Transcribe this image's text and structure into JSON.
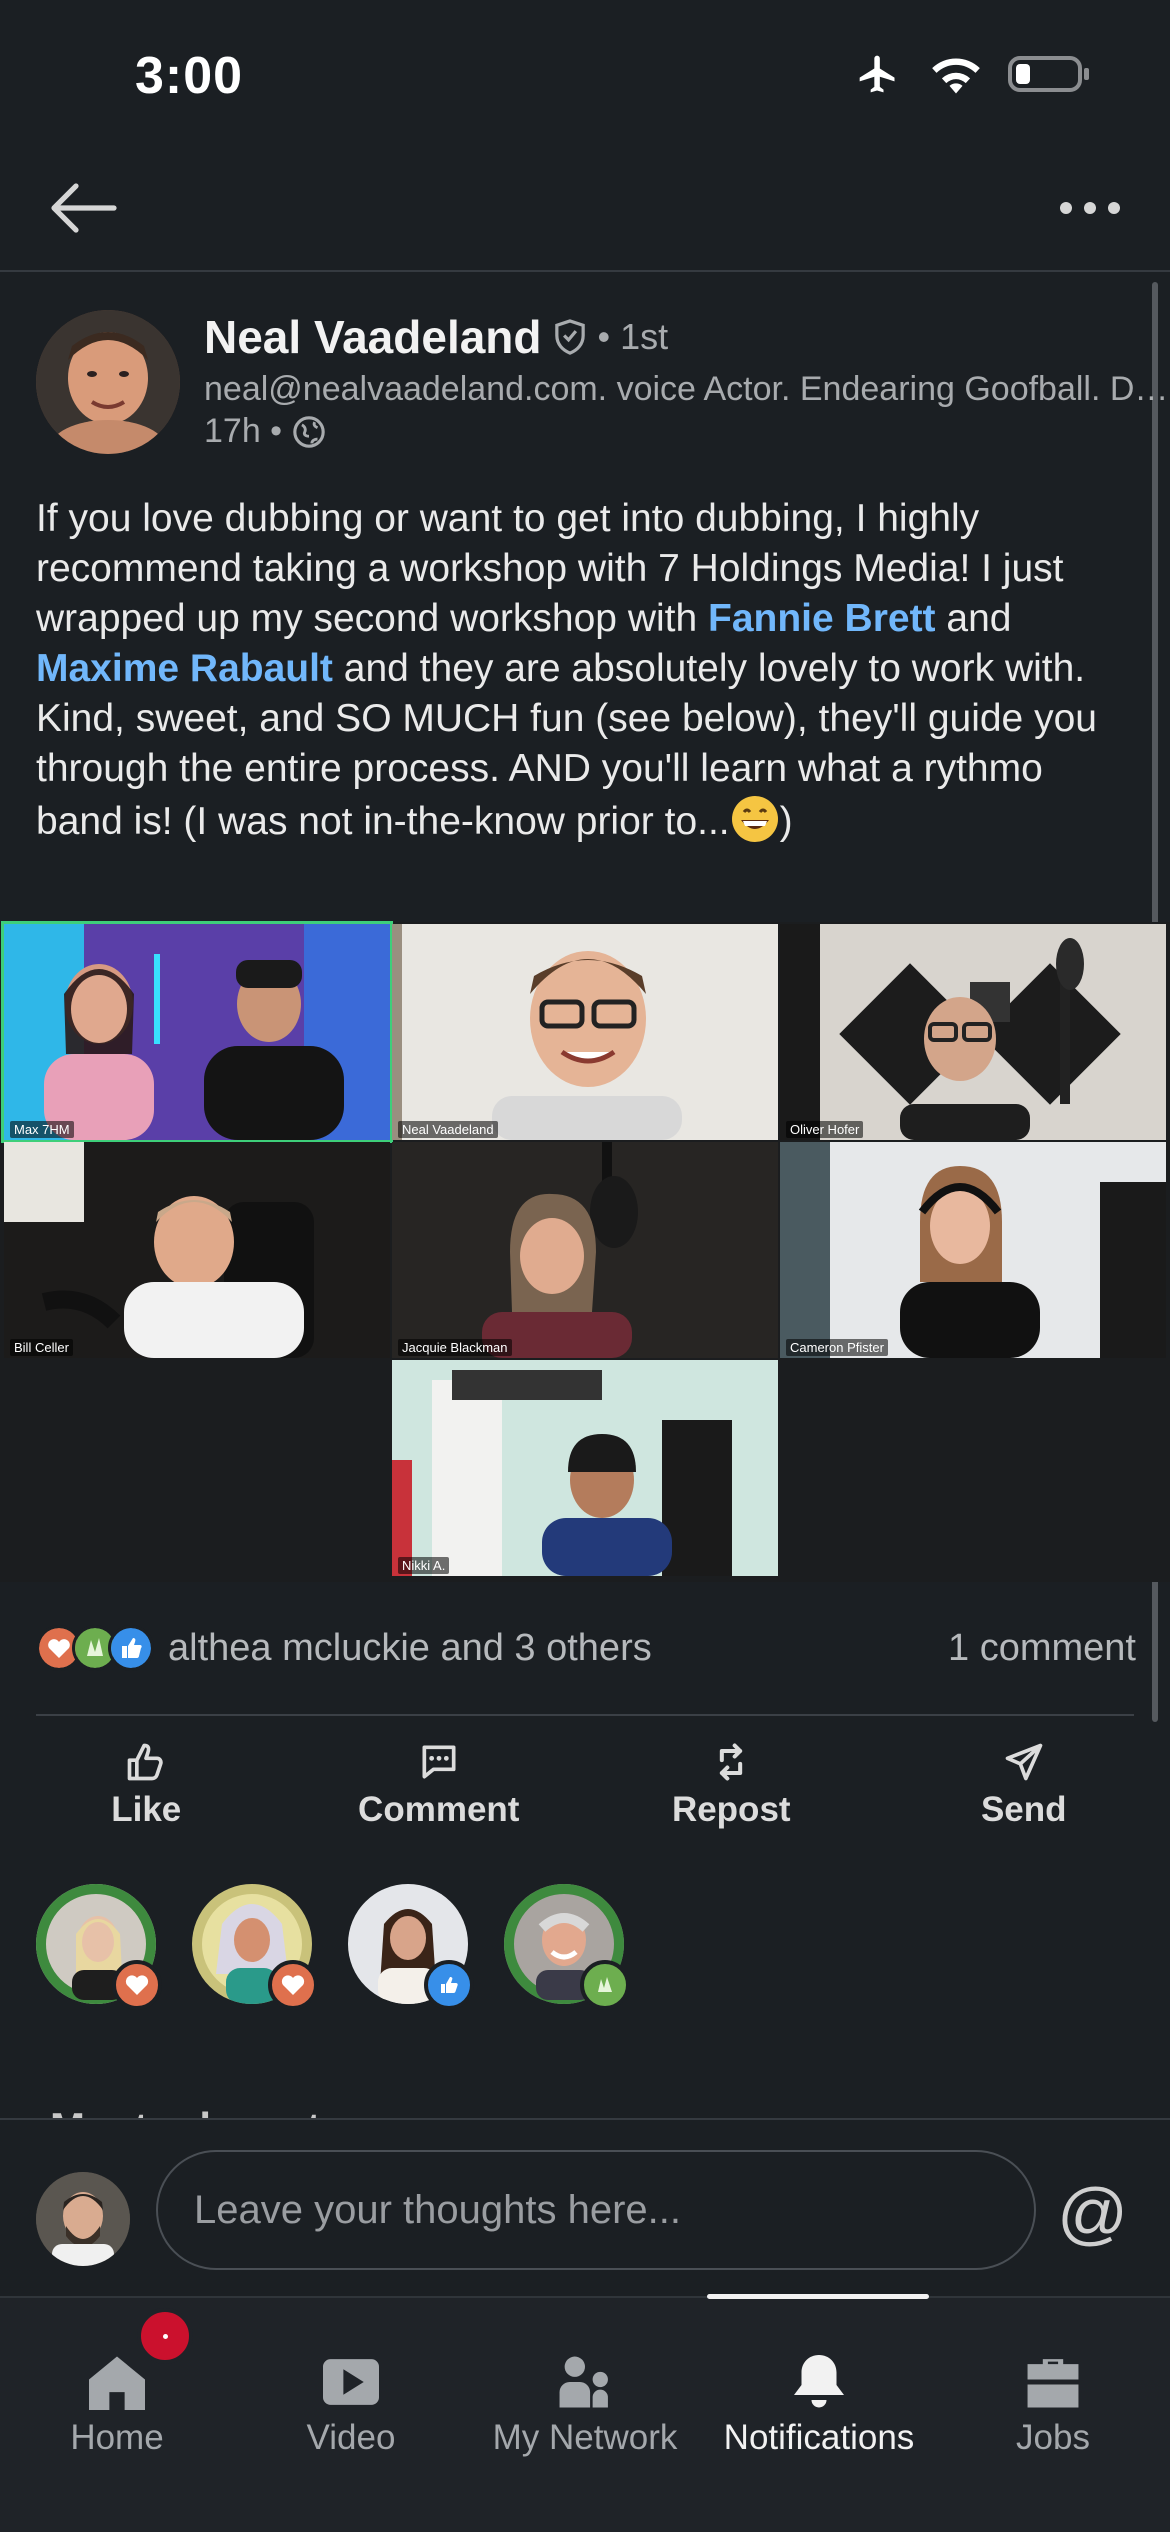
{
  "status_bar": {
    "time": "3:00"
  },
  "post": {
    "author": {
      "name": "Neal Vaadeland",
      "degree": "• 1st",
      "headline": "neal@nealvaadeland.com. voice Actor. Endearing Goofball. Dubbing.",
      "time": "17h •"
    },
    "body": {
      "part1": "If you love dubbing or want to get into dubbing, I highly recommend taking a workshop with 7 Holdings Media! I just wrapped up my second workshop with ",
      "mention1": "Fannie Brett",
      "part2": " and ",
      "mention2": "Maxime Rabault",
      "part3": " and they are absolutely lovely to work with. Kind, sweet, and SO MUCH fun (see below), they'll guide you through the entire process. AND you'll learn what a rythmo band is! (I was not in-the-know prior to...",
      "part4": ")"
    },
    "video_tiles": [
      {
        "label": "Max 7HM"
      },
      {
        "label": "Neal Vaadeland"
      },
      {
        "label": "Oliver Hofer"
      },
      {
        "label": "Bill Celler"
      },
      {
        "label": "Jacquie Blackman"
      },
      {
        "label": "Cameron Pfister"
      },
      {
        "label": "Nikki A."
      }
    ],
    "reactions": {
      "summary": "althea mcluckie and 3 others",
      "comments": "1 comment",
      "icons": [
        "heart-reaction",
        "celebrate-reaction",
        "like-reaction"
      ]
    },
    "actions": [
      {
        "label": "Like",
        "icon": "like-icon"
      },
      {
        "label": "Comment",
        "icon": "comment-icon"
      },
      {
        "label": "Repost",
        "icon": "repost-icon"
      },
      {
        "label": "Send",
        "icon": "send-icon"
      }
    ],
    "most_relevant": "Most relevant"
  },
  "composer": {
    "placeholder": "Leave your thoughts here...",
    "mention_symbol": "@"
  },
  "tab_bar": {
    "tabs": [
      {
        "label": "Home",
        "icon": "home-icon"
      },
      {
        "label": "Video",
        "icon": "video-icon"
      },
      {
        "label": "My Network",
        "icon": "network-icon"
      },
      {
        "label": "Notifications",
        "icon": "bell-icon",
        "active": true
      },
      {
        "label": "Jobs",
        "icon": "briefcase-icon"
      }
    ]
  },
  "colors": {
    "background": "#1b1f23",
    "mention": "#71b7fb",
    "badge": "#cb112d",
    "like_blue": "#378fe9",
    "love_red": "#df704d",
    "celebrate_green": "#6dae4f"
  }
}
